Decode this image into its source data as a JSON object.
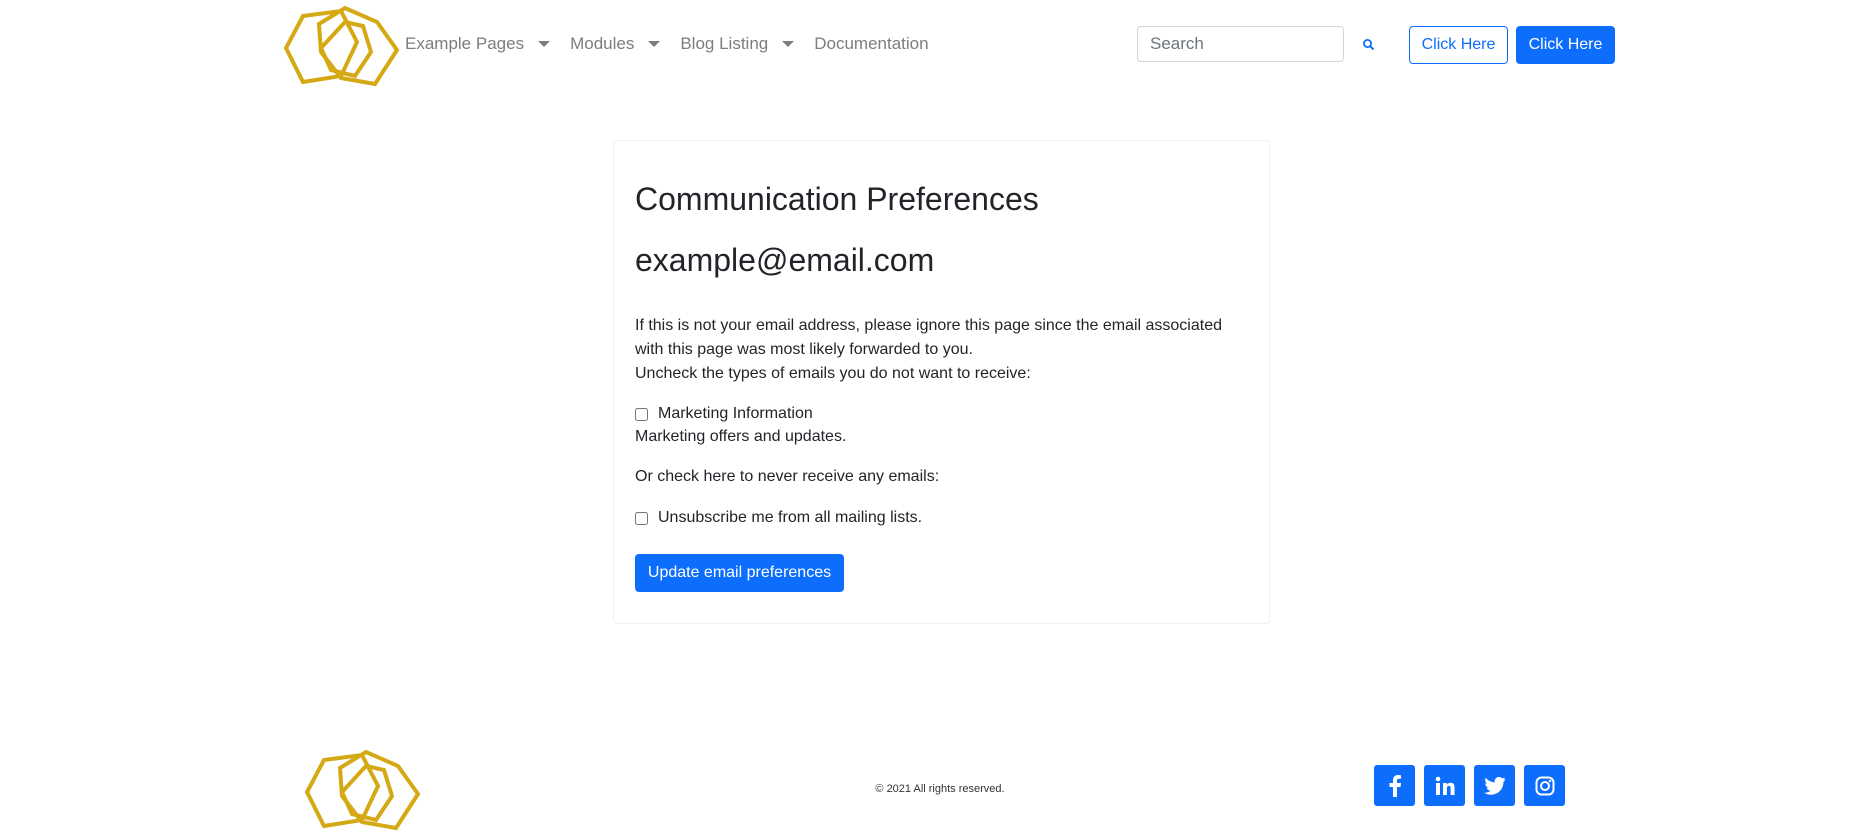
{
  "header": {
    "nav": [
      {
        "label": "Example Pages",
        "has_dropdown": true
      },
      {
        "label": "Modules",
        "has_dropdown": true
      },
      {
        "label": "Blog Listing",
        "has_dropdown": true
      },
      {
        "label": "Documentation",
        "has_dropdown": false
      }
    ],
    "search": {
      "placeholder": "Search",
      "value": ""
    },
    "buttons": {
      "outline_label": "Click Here",
      "primary_label": "Click Here"
    }
  },
  "main": {
    "title": "Communication Preferences",
    "email": "example@email.com",
    "intro_line1": "If this is not your email address, please ignore this page since the email associated",
    "intro_line2": "with this page was most likely forwarded to you.",
    "intro_line3": "Uncheck the types of emails you do not want to receive:",
    "options": [
      {
        "label": "Marketing Information",
        "description": "Marketing offers and updates.",
        "checked": false
      }
    ],
    "or_text": "Or check here to never receive any emails:",
    "unsubscribe": {
      "label": "Unsubscribe me from all mailing lists.",
      "checked": false
    },
    "submit_label": "Update email preferences"
  },
  "footer": {
    "copyright": "© 2021 All rights reserved.",
    "social_icons": [
      "facebook-icon",
      "linkedin-icon",
      "twitter-icon",
      "instagram-icon"
    ]
  },
  "colors": {
    "accent": "#0d6efd",
    "logo": "#d4a914",
    "nav_text": "#7d7d7d",
    "body_text": "#212529"
  }
}
